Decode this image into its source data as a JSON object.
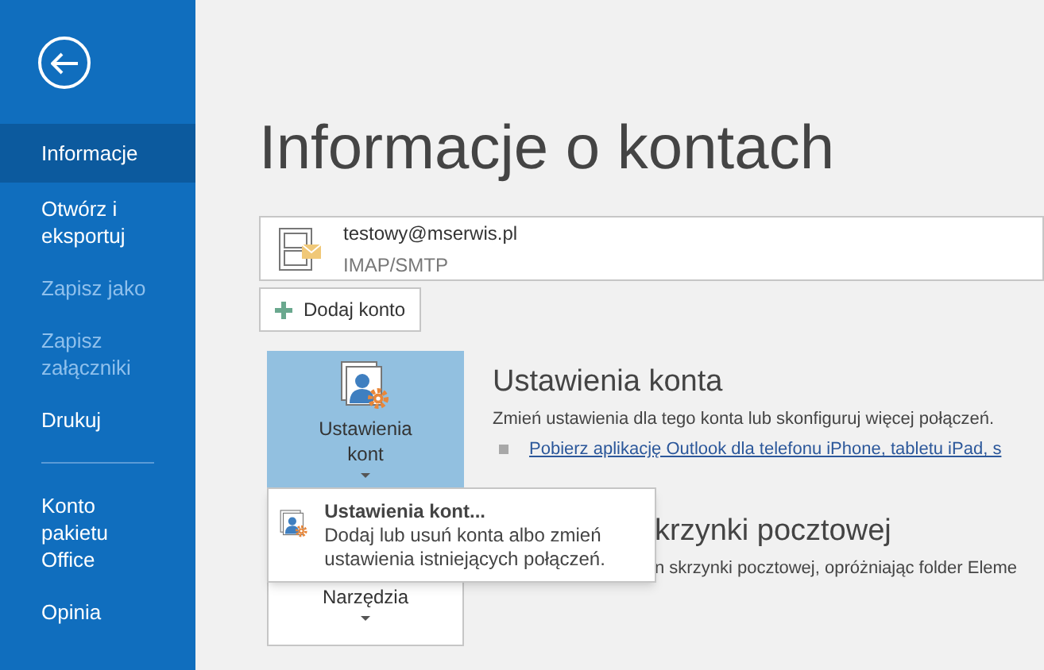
{
  "sidebar": {
    "groups": [
      [
        {
          "label": "Informacje",
          "selected": true,
          "disabled": false
        },
        {
          "label": "Otwórz i eksportuj",
          "selected": false,
          "disabled": false
        },
        {
          "label": "Zapisz jako",
          "selected": false,
          "disabled": true
        },
        {
          "label": "Zapisz załączniki",
          "selected": false,
          "disabled": true
        },
        {
          "label": "Drukuj",
          "selected": false,
          "disabled": false
        }
      ],
      [
        {
          "label": "Konto pakietu Office",
          "selected": false,
          "disabled": false
        },
        {
          "label": "Opinia",
          "selected": false,
          "disabled": false
        }
      ]
    ]
  },
  "page_title": "Informacje o kontach",
  "account": {
    "email": "testowy@mserwis.pl",
    "type": "IMAP/SMTP"
  },
  "add_account_button": "Dodaj konto",
  "sections": [
    {
      "kind": "settings",
      "tile_label": "Ustawienia kont",
      "selected": true,
      "heading": "Ustawienia konta",
      "description": "Zmień ustawienia dla tego konta lub skonfiguruj więcej połączeń.",
      "links": [
        "Pobierz aplikację Outlook dla telefonu iPhone, tabletu iPad, s"
      ]
    },
    {
      "kind": "tools",
      "tile_label": "Narzędzia",
      "selected": false,
      "heading": "krzynki pocztowej",
      "description": "n skrzynki pocztowej, opróżniając folder Eleme"
    }
  ],
  "dropdown_menu": {
    "items": [
      {
        "title": "Ustawienia kont...",
        "description": "Dodaj lub usuń konta albo zmień ustawienia istniejących połączeń."
      }
    ]
  }
}
